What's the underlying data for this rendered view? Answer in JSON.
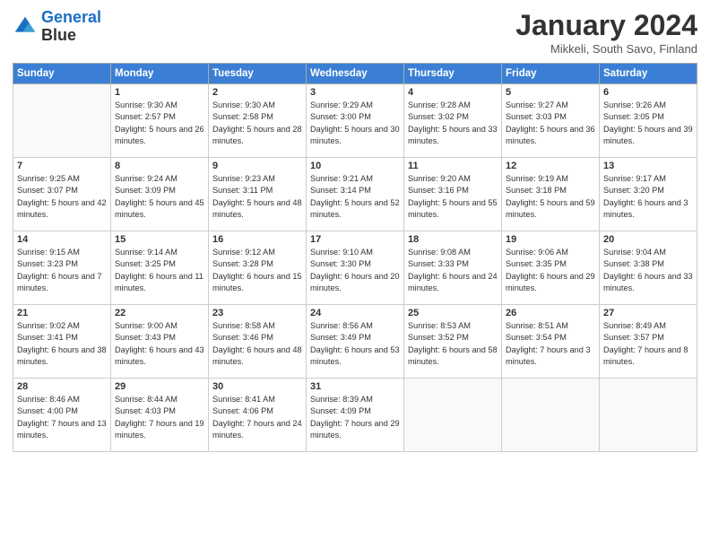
{
  "header": {
    "logo_line1": "General",
    "logo_line2": "Blue",
    "month_title": "January 2024",
    "subtitle": "Mikkeli, South Savo, Finland"
  },
  "weekdays": [
    "Sunday",
    "Monday",
    "Tuesday",
    "Wednesday",
    "Thursday",
    "Friday",
    "Saturday"
  ],
  "weeks": [
    [
      {
        "day": "",
        "sunrise": "",
        "sunset": "",
        "daylight": ""
      },
      {
        "day": "1",
        "sunrise": "9:30 AM",
        "sunset": "2:57 PM",
        "daylight": "5 hours and 26 minutes."
      },
      {
        "day": "2",
        "sunrise": "9:30 AM",
        "sunset": "2:58 PM",
        "daylight": "5 hours and 28 minutes."
      },
      {
        "day": "3",
        "sunrise": "9:29 AM",
        "sunset": "3:00 PM",
        "daylight": "5 hours and 30 minutes."
      },
      {
        "day": "4",
        "sunrise": "9:28 AM",
        "sunset": "3:02 PM",
        "daylight": "5 hours and 33 minutes."
      },
      {
        "day": "5",
        "sunrise": "9:27 AM",
        "sunset": "3:03 PM",
        "daylight": "5 hours and 36 minutes."
      },
      {
        "day": "6",
        "sunrise": "9:26 AM",
        "sunset": "3:05 PM",
        "daylight": "5 hours and 39 minutes."
      }
    ],
    [
      {
        "day": "7",
        "sunrise": "9:25 AM",
        "sunset": "3:07 PM",
        "daylight": "5 hours and 42 minutes."
      },
      {
        "day": "8",
        "sunrise": "9:24 AM",
        "sunset": "3:09 PM",
        "daylight": "5 hours and 45 minutes."
      },
      {
        "day": "9",
        "sunrise": "9:23 AM",
        "sunset": "3:11 PM",
        "daylight": "5 hours and 48 minutes."
      },
      {
        "day": "10",
        "sunrise": "9:21 AM",
        "sunset": "3:14 PM",
        "daylight": "5 hours and 52 minutes."
      },
      {
        "day": "11",
        "sunrise": "9:20 AM",
        "sunset": "3:16 PM",
        "daylight": "5 hours and 55 minutes."
      },
      {
        "day": "12",
        "sunrise": "9:19 AM",
        "sunset": "3:18 PM",
        "daylight": "5 hours and 59 minutes."
      },
      {
        "day": "13",
        "sunrise": "9:17 AM",
        "sunset": "3:20 PM",
        "daylight": "6 hours and 3 minutes."
      }
    ],
    [
      {
        "day": "14",
        "sunrise": "9:15 AM",
        "sunset": "3:23 PM",
        "daylight": "6 hours and 7 minutes."
      },
      {
        "day": "15",
        "sunrise": "9:14 AM",
        "sunset": "3:25 PM",
        "daylight": "6 hours and 11 minutes."
      },
      {
        "day": "16",
        "sunrise": "9:12 AM",
        "sunset": "3:28 PM",
        "daylight": "6 hours and 15 minutes."
      },
      {
        "day": "17",
        "sunrise": "9:10 AM",
        "sunset": "3:30 PM",
        "daylight": "6 hours and 20 minutes."
      },
      {
        "day": "18",
        "sunrise": "9:08 AM",
        "sunset": "3:33 PM",
        "daylight": "6 hours and 24 minutes."
      },
      {
        "day": "19",
        "sunrise": "9:06 AM",
        "sunset": "3:35 PM",
        "daylight": "6 hours and 29 minutes."
      },
      {
        "day": "20",
        "sunrise": "9:04 AM",
        "sunset": "3:38 PM",
        "daylight": "6 hours and 33 minutes."
      }
    ],
    [
      {
        "day": "21",
        "sunrise": "9:02 AM",
        "sunset": "3:41 PM",
        "daylight": "6 hours and 38 minutes."
      },
      {
        "day": "22",
        "sunrise": "9:00 AM",
        "sunset": "3:43 PM",
        "daylight": "6 hours and 43 minutes."
      },
      {
        "day": "23",
        "sunrise": "8:58 AM",
        "sunset": "3:46 PM",
        "daylight": "6 hours and 48 minutes."
      },
      {
        "day": "24",
        "sunrise": "8:56 AM",
        "sunset": "3:49 PM",
        "daylight": "6 hours and 53 minutes."
      },
      {
        "day": "25",
        "sunrise": "8:53 AM",
        "sunset": "3:52 PM",
        "daylight": "6 hours and 58 minutes."
      },
      {
        "day": "26",
        "sunrise": "8:51 AM",
        "sunset": "3:54 PM",
        "daylight": "7 hours and 3 minutes."
      },
      {
        "day": "27",
        "sunrise": "8:49 AM",
        "sunset": "3:57 PM",
        "daylight": "7 hours and 8 minutes."
      }
    ],
    [
      {
        "day": "28",
        "sunrise": "8:46 AM",
        "sunset": "4:00 PM",
        "daylight": "7 hours and 13 minutes."
      },
      {
        "day": "29",
        "sunrise": "8:44 AM",
        "sunset": "4:03 PM",
        "daylight": "7 hours and 19 minutes."
      },
      {
        "day": "30",
        "sunrise": "8:41 AM",
        "sunset": "4:06 PM",
        "daylight": "7 hours and 24 minutes."
      },
      {
        "day": "31",
        "sunrise": "8:39 AM",
        "sunset": "4:09 PM",
        "daylight": "7 hours and 29 minutes."
      },
      {
        "day": "",
        "sunrise": "",
        "sunset": "",
        "daylight": ""
      },
      {
        "day": "",
        "sunrise": "",
        "sunset": "",
        "daylight": ""
      },
      {
        "day": "",
        "sunrise": "",
        "sunset": "",
        "daylight": ""
      }
    ]
  ]
}
